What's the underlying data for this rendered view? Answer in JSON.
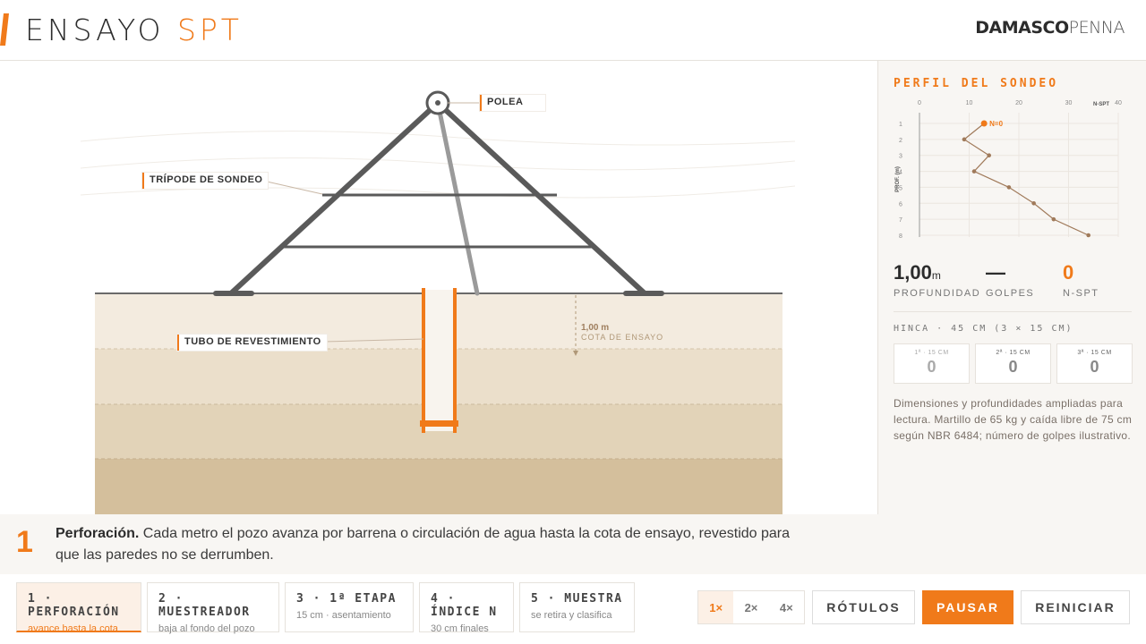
{
  "header": {
    "title_main": "ENSAYO",
    "title_accent": "SPT",
    "logo_bold": "DAMASCO",
    "logo_light": "PENNA"
  },
  "scene": {
    "labels": {
      "polea": "POLEA",
      "tripode": "TRÍPODE DE SONDEO",
      "tubo": "TUBO DE REVESTIMIENTO"
    },
    "cota_value": "1,00 m",
    "cota_label": "COTA DE ENSAYO"
  },
  "side": {
    "title": "PERFIL DEL SONDEO",
    "chart_data": {
      "type": "line",
      "xlabel": "N-SPT",
      "ylabel": "PROF. (m)",
      "x_ticks": [
        "0",
        "10",
        "20",
        "30",
        "40"
      ],
      "y_ticks": [
        "1",
        "2",
        "3",
        "4",
        "5",
        "6",
        "7",
        "8"
      ],
      "xlim": [
        0,
        40
      ],
      "ylim": [
        1,
        8
      ],
      "points": [
        {
          "depth": 2,
          "n": 9
        },
        {
          "depth": 3,
          "n": 14
        },
        {
          "depth": 4,
          "n": 11
        },
        {
          "depth": 5,
          "n": 18
        },
        {
          "depth": 6,
          "n": 23
        },
        {
          "depth": 7,
          "n": 27
        },
        {
          "depth": 8,
          "n": 34
        }
      ],
      "current": {
        "depth": 1,
        "n": 13,
        "label": "N=0"
      },
      "colors": {
        "line": "#a07a5a",
        "current": "#f07a1a"
      }
    },
    "metrics": {
      "depth_value": "1,00",
      "depth_unit": "m",
      "depth_label": "PROFUNDIDAD",
      "golpes_value": "—",
      "golpes_label": "GOLPES",
      "nspt_value": "0",
      "nspt_label": "N-SPT"
    },
    "hinca_title": "HINCA · 45 CM (3 × 15 CM)",
    "stages": [
      {
        "label": "1ª · 15 CM",
        "value": "0"
      },
      {
        "label": "2ª · 15 CM",
        "value": "0"
      },
      {
        "label": "3ª · 15 CM",
        "value": "0"
      }
    ],
    "note": "Dimensiones y profundidades ampliadas para lectura. Martillo de 65 kg y caída libre de 75 cm según NBR 6484; número de golpes ilustrativo."
  },
  "description": {
    "number": "1",
    "bold": "Perforación.",
    "text": " Cada metro el pozo avanza por barrena o circulación de agua hasta la cota de ensayo, revestido para que las paredes no se derrumben."
  },
  "steps": [
    {
      "label": "1 · PERFORACIÓN",
      "sub": "avance hasta la cota"
    },
    {
      "label": "2 · MUESTREADOR",
      "sub": "baja al fondo del pozo"
    },
    {
      "label": "3 · 1ª ETAPA",
      "sub": "15 cm · asentamiento"
    },
    {
      "label": "4 · ÍNDICE N",
      "sub": "30 cm finales"
    },
    {
      "label": "5 · MUESTRA",
      "sub": "se retira y clasifica"
    }
  ],
  "controls": {
    "speeds": [
      "1×",
      "2×",
      "4×"
    ],
    "rotulos": "RÓTULOS",
    "pausar": "PAUSAR",
    "reiniciar": "REINICIAR"
  },
  "colors": {
    "accent": "#f07a1a",
    "frame": "#5a5a5a",
    "soil1": "#f3ebdf",
    "soil2": "#ebdfcb",
    "soil3": "#e2d3b8",
    "soil4": "#d4bf9c"
  }
}
